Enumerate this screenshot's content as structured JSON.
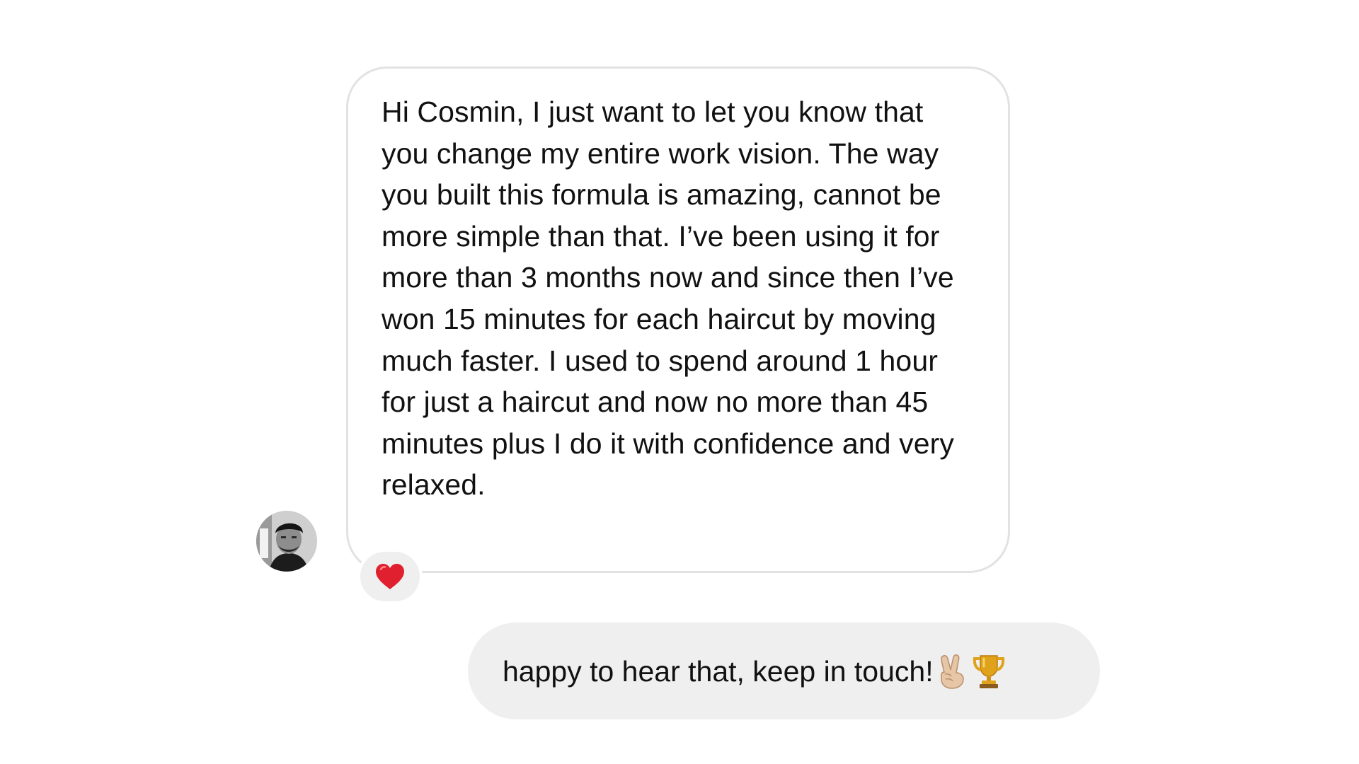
{
  "conversation": {
    "incoming": {
      "sender_avatar": "user-avatar-photo",
      "text": "Hi Cosmin, I just want to let you know that you change my entire work vision. The way you built this formula is amazing, cannot be more simple than that. I’ve been using it for more than 3 months now and since then I’ve won 15 minutes for each haircut by moving much faster. I used to spend around 1 hour for just a haircut and now no more than 45 minutes plus I do it with confidence and very relaxed.",
      "reaction": "heart-icon"
    },
    "outgoing": {
      "text": "happy to hear that, keep in touch!",
      "emojis": [
        "victory-hand-icon",
        "trophy-icon"
      ]
    }
  },
  "colors": {
    "incoming_border": "#e2e2e2",
    "outgoing_background": "#efefef",
    "reaction_background": "#efefef",
    "heart": "#e0202e",
    "trophy": "#e0a21a"
  }
}
